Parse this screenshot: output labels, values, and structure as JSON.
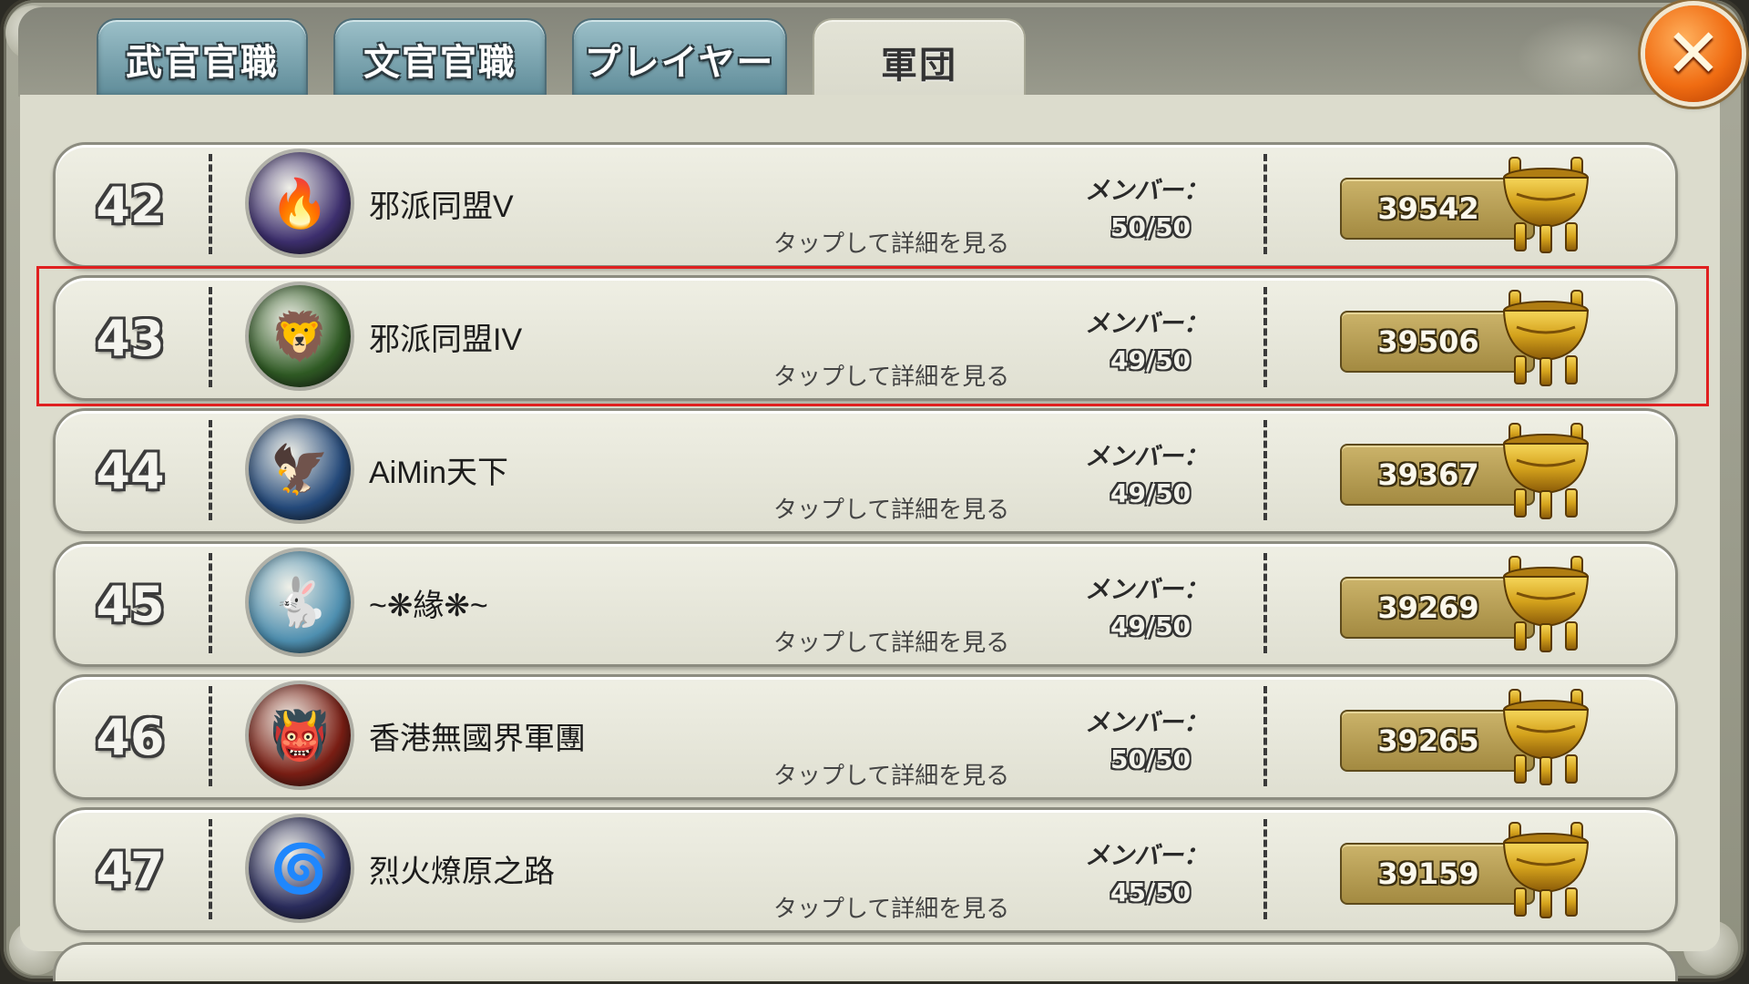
{
  "tabs": [
    {
      "label": "武官官職",
      "active": false
    },
    {
      "label": "文官官職",
      "active": false
    },
    {
      "label": "プレイヤー",
      "active": false
    },
    {
      "label": "軍団",
      "active": true
    }
  ],
  "close_button": {
    "glyph": "✕"
  },
  "common": {
    "detail_label": "タップして詳細を見る",
    "member_label": "メンバー："
  },
  "legions": [
    {
      "rank": "42",
      "name": "邪派同盟V",
      "members": "50/50",
      "score": "39542",
      "emblem": "phoenix-emblem",
      "emblem_glyph": "🔥",
      "emblem_color": "#3d2f6e"
    },
    {
      "rank": "43",
      "name": "邪派同盟IV",
      "members": "49/50",
      "score": "39506",
      "emblem": "lion-shield-emblem",
      "emblem_glyph": "🦁",
      "emblem_color": "#2f5a24",
      "highlighted": true
    },
    {
      "rank": "44",
      "name": "AiMin天下",
      "members": "49/50",
      "score": "39367",
      "emblem": "eagle-emblem",
      "emblem_glyph": "🦅",
      "emblem_color": "#24497a"
    },
    {
      "rank": "45",
      "name": "~❋緣❋~",
      "members": "49/50",
      "score": "39269",
      "emblem": "rabbit-moon-emblem",
      "emblem_glyph": "🐇",
      "emblem_color": "#4e8fb0"
    },
    {
      "rank": "46",
      "name": "香港無國界軍團",
      "members": "50/50",
      "score": "39265",
      "emblem": "demon-mask-emblem",
      "emblem_glyph": "👹",
      "emblem_color": "#7a1e14"
    },
    {
      "rank": "47",
      "name": "烈火燎原之路",
      "members": "45/50",
      "score": "39159",
      "emblem": "fire-vortex-emblem",
      "emblem_glyph": "🌀",
      "emblem_color": "#2a2c5c"
    }
  ],
  "colors": {
    "highlight": "#e02020",
    "tab_inactive": "#6f98a4",
    "tab_active": "#e0e0d2",
    "close_button": "#f06c12",
    "score_box": "#b89c52"
  }
}
